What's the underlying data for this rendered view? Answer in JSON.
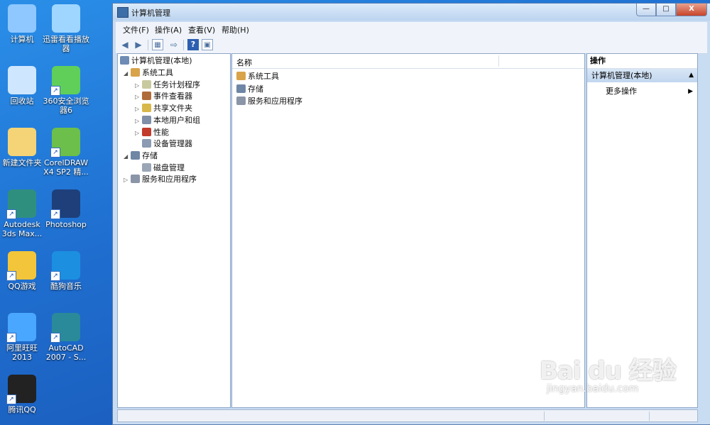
{
  "desktop": {
    "icons": [
      {
        "label": "计算机",
        "icon": "computer-icon",
        "color": "#8fc7ff"
      },
      {
        "label": "迅雷看看播放器",
        "icon": "xunlei-icon",
        "color": "#9fd6ff"
      },
      {
        "label": "回收站",
        "icon": "recycle-bin-icon",
        "color": "#cfe6ff"
      },
      {
        "label": "360安全浏览器6",
        "icon": "browser-icon",
        "color": "#5fcf5a"
      },
      {
        "label": "新建文件夹",
        "icon": "folder-icon",
        "color": "#f4d476"
      },
      {
        "label": "CorelDRAW X4 SP2 精...",
        "icon": "coreldraw-icon",
        "color": "#6bbf4a"
      },
      {
        "label": "Autodesk 3ds Max...",
        "icon": "3dsmax-icon",
        "color": "#2f8f7f"
      },
      {
        "label": "Photoshop",
        "icon": "photoshop-icon",
        "color": "#1e3f7a"
      },
      {
        "label": "QQ游戏",
        "icon": "qq-game-icon",
        "color": "#f3c53a"
      },
      {
        "label": "酷狗音乐",
        "icon": "kugou-icon",
        "color": "#1c8fe0"
      },
      {
        "label": "阿里旺旺2013",
        "icon": "aliwangwang-icon",
        "color": "#49a7ff"
      },
      {
        "label": "AutoCAD 2007 - S...",
        "icon": "autocad-icon",
        "color": "#2a8a9a"
      },
      {
        "label": "腾讯QQ",
        "icon": "qq-icon",
        "color": "#222222"
      }
    ]
  },
  "window": {
    "title": "计算机管理",
    "controls": {
      "min": "—",
      "max": "□",
      "close": "X"
    }
  },
  "menu": {
    "items": [
      "文件(F)",
      "操作(A)",
      "查看(V)",
      "帮助(H)"
    ]
  },
  "toolbar": {
    "back": "◀",
    "forward": "▶",
    "show_hide": "▦",
    "export": "⇨",
    "help": "?",
    "properties": "▣"
  },
  "tree": {
    "root": "计算机管理(本地)",
    "items": [
      {
        "label": "系统工具",
        "exp": "◢",
        "icon": "tools-icon",
        "color": "#d8a34a"
      },
      {
        "label": "任务计划程序",
        "exp": "▷",
        "icon": "clock-icon",
        "color": "#c9c9a0"
      },
      {
        "label": "事件查看器",
        "exp": "▷",
        "icon": "event-viewer-icon",
        "color": "#b06b3a"
      },
      {
        "label": "共享文件夹",
        "exp": "▷",
        "icon": "shared-folder-icon",
        "color": "#d8b84a"
      },
      {
        "label": "本地用户和组",
        "exp": "▷",
        "icon": "users-icon",
        "color": "#7f8fa8"
      },
      {
        "label": "性能",
        "exp": "▷",
        "icon": "performance-icon",
        "color": "#c23b2b"
      },
      {
        "label": "设备管理器",
        "exp": "",
        "icon": "device-manager-icon",
        "color": "#8a9bb3"
      },
      {
        "label": "存储",
        "exp": "◢",
        "icon": "storage-icon",
        "color": "#6f86a5"
      },
      {
        "label": "磁盘管理",
        "exp": "",
        "icon": "disk-icon",
        "color": "#9aa6b5"
      },
      {
        "label": "服务和应用程序",
        "exp": "▷",
        "icon": "services-icon",
        "color": "#8a95a8"
      }
    ]
  },
  "center": {
    "column": "名称",
    "rows": [
      {
        "label": "系统工具",
        "icon": "tools-icon",
        "color": "#d8a34a"
      },
      {
        "label": "存储",
        "icon": "storage-icon",
        "color": "#6f86a5"
      },
      {
        "label": "服务和应用程序",
        "icon": "services-icon",
        "color": "#8a95a8"
      }
    ]
  },
  "actions": {
    "header": "操作",
    "section": "计算机管理(本地)",
    "section_arrow": "▲",
    "item": "更多操作",
    "item_arrow": "▶"
  },
  "watermark": {
    "brand": "Bai du 经验",
    "url": "jingyan.baidu.com"
  }
}
